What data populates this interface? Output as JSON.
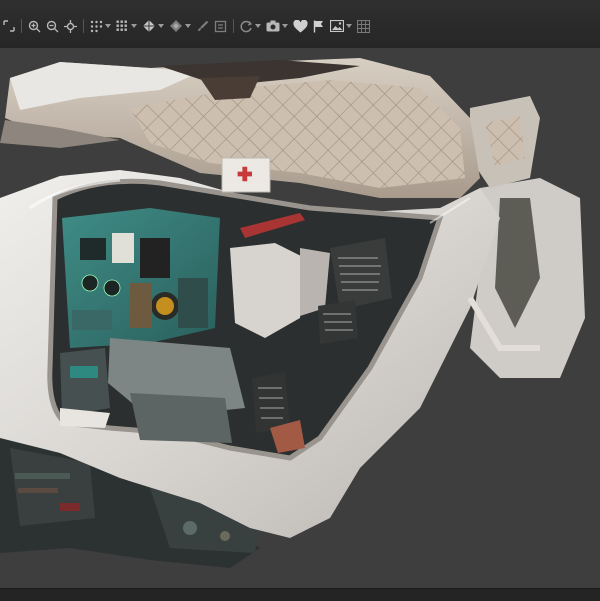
{
  "app": {
    "theme": {
      "toolbar_bg": "#2a2a2a",
      "viewport_bg": "#3e3e3e",
      "icon_color": "#b8b8b8"
    }
  },
  "toolbar": {
    "tools": [
      {
        "icon": "selection-icon",
        "has_menu": false
      },
      {
        "icon": "zoom-in-icon",
        "has_menu": false
      },
      {
        "icon": "zoom-out-icon",
        "has_menu": false
      },
      {
        "icon": "crosshair-icon",
        "has_menu": false
      },
      {
        "icon": "point-cloud-icon",
        "has_menu": true
      },
      {
        "icon": "dense-cloud-icon",
        "has_menu": true
      },
      {
        "icon": "mesh-icon",
        "has_menu": true
      },
      {
        "icon": "texture-icon",
        "has_menu": true
      },
      {
        "icon": "brush-icon",
        "has_menu": false
      },
      {
        "icon": "layers-icon",
        "has_menu": false
      },
      {
        "icon": "rotate-icon",
        "has_menu": true
      },
      {
        "icon": "camera-icon",
        "has_menu": true
      },
      {
        "icon": "heart-icon",
        "has_menu": false
      },
      {
        "icon": "flag-icon",
        "has_menu": false
      },
      {
        "icon": "image-icon",
        "has_menu": true
      },
      {
        "icon": "grid-icon",
        "has_menu": false
      }
    ]
  },
  "viewport": {
    "content": "3d-model-cockpit"
  }
}
